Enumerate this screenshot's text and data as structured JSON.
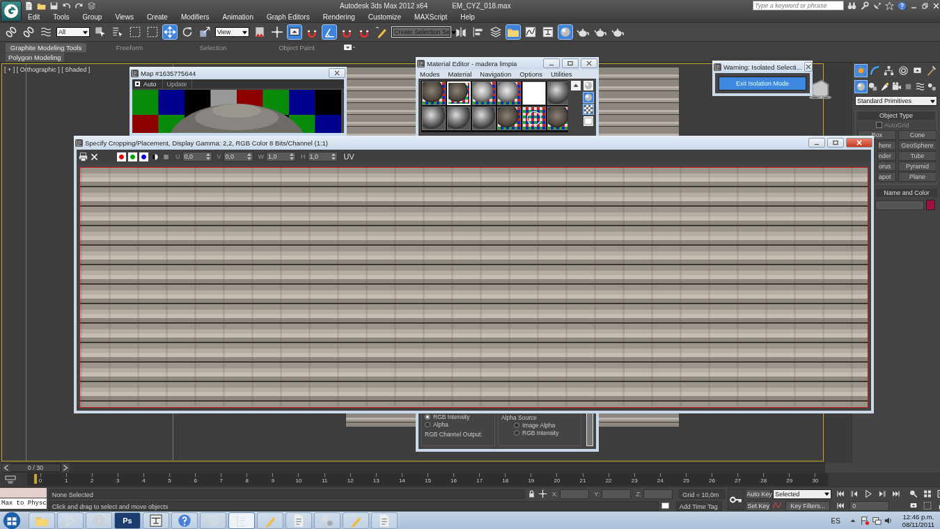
{
  "title_bar": {
    "app": "Autodesk 3ds Max  2012 x64",
    "file": "EM_CYZ_018.max",
    "search": {
      "placeholder": "Type a keyword or phrase"
    }
  },
  "menu": [
    "Edit",
    "Tools",
    "Group",
    "Views",
    "Create",
    "Modifiers",
    "Animation",
    "Graph Editors",
    "Rendering",
    "Customize",
    "MAXScript",
    "Help"
  ],
  "main_toolbar": {
    "selection_filter": "All",
    "reference_coordinate": "View",
    "named_selection": "Create Selection Se",
    "tools": [
      {
        "on": false
      },
      {
        "on": false
      },
      {
        "on": false
      },
      {
        "on": false
      },
      {
        "on": false
      },
      {
        "on": false
      },
      {
        "on": false
      },
      {
        "on": true
      },
      {
        "on": false
      },
      {
        "on": false
      },
      {
        "on": false
      },
      {
        "on": false
      },
      {
        "on": true
      },
      {
        "on": false
      },
      {
        "on": true
      },
      {
        "on": false
      },
      {
        "on": false
      },
      {
        "on": false
      },
      {
        "on": false
      },
      {
        "on": false
      },
      {
        "on": false
      },
      {
        "on": true
      },
      {
        "on": false
      },
      {
        "on": false
      },
      {
        "on": true
      },
      {
        "on": false
      },
      {
        "on": false
      },
      {
        "on": false
      }
    ]
  },
  "ribbon": {
    "tabs": [
      {
        "label": "Graphite Modeling Tools",
        "selected": true
      },
      {
        "label": "Freeform",
        "selected": false
      },
      {
        "label": "Selection",
        "selected": false
      },
      {
        "label": "Object Paint",
        "selected": false
      }
    ],
    "panel": "Polygon Modeling"
  },
  "viewport": {
    "label": "[ + ] [ Orthographic ] [ Shaded ]"
  },
  "map_window": {
    "title": "Map #1635775644",
    "auto": {
      "label": "Auto",
      "checked": true
    },
    "update": "Update"
  },
  "material_editor": {
    "title": "Material Editor - madera limpia",
    "menu": [
      "Modes",
      "Material",
      "Navigation",
      "Options",
      "Utilities"
    ],
    "slots": [
      {
        "kind": "textured",
        "selected": false
      },
      {
        "kind": "textured",
        "selected": true
      },
      {
        "kind": "checkered",
        "selected": false
      },
      {
        "kind": "checkered",
        "selected": false
      },
      {
        "kind": "blank",
        "selected": false
      },
      {
        "kind": "plain",
        "selected": false
      },
      {
        "kind": "plain",
        "selected": false
      },
      {
        "kind": "plain",
        "selected": false
      },
      {
        "kind": "plain",
        "selected": false
      },
      {
        "kind": "textured",
        "selected": false
      },
      {
        "kind": "patterned",
        "selected": false
      },
      {
        "kind": "textured",
        "selected": false
      }
    ],
    "mono_output": [
      {
        "label": "RGB Intensity",
        "selected": true
      },
      {
        "label": "Alpha",
        "selected": false
      }
    ],
    "rgb_channel_output": "RGB Channel Output:",
    "alpha_source": {
      "title": "Alpha Source",
      "options": [
        {
          "label": "Image Alpha",
          "selected": false
        },
        {
          "label": "RGB Intensity",
          "selected": false
        }
      ]
    }
  },
  "warning_window": {
    "title": "Warning: Isolated Selecti...",
    "button": "Exit Isolation Mode"
  },
  "crop_dialog": {
    "title": "Specify Cropping/Placement, Display Gamma: 2,2, RGB Color 8 Bits/Channel (1:1)",
    "channels": [
      {
        "color": "#e00000",
        "on": true
      },
      {
        "color": "#00a000",
        "on": true
      },
      {
        "color": "#0000e0",
        "on": true
      }
    ],
    "fields": [
      {
        "label": "U",
        "value": "0,0"
      },
      {
        "label": "V",
        "value": "0,0"
      },
      {
        "label": "W",
        "value": "1,0"
      },
      {
        "label": "H",
        "value": "1,0"
      }
    ],
    "uv": "UV"
  },
  "command_panel": {
    "tabs": [
      {
        "selected": true
      },
      {
        "selected": false
      },
      {
        "selected": false
      },
      {
        "selected": false
      },
      {
        "selected": false
      },
      {
        "selected": false
      }
    ],
    "categories": [
      {
        "selected": true
      },
      {
        "selected": false
      },
      {
        "selected": false
      },
      {
        "selected": false
      },
      {
        "selected": false
      },
      {
        "selected": false
      },
      {
        "selected": false
      }
    ],
    "type": "Standard Primitives",
    "object_type": {
      "title": "Object Type",
      "autogrid": {
        "label": "AutoGrid",
        "checked": false
      },
      "buttons": [
        "Box",
        "Cone",
        "here",
        "GeoSphere",
        "nder",
        "Tube",
        "orus",
        "Pyramid",
        "apot",
        "Plane"
      ]
    },
    "name_and_color": {
      "title": "Name and Color",
      "color": "#9e1040"
    }
  },
  "timeline": {
    "position": "0 / 30",
    "ticks": [
      "0",
      "1",
      "2",
      "3",
      "4",
      "5",
      "6",
      "7",
      "8",
      "9",
      "10",
      "11",
      "12",
      "13",
      "14",
      "15",
      "16",
      "17",
      "18",
      "19",
      "20",
      "21",
      "22",
      "23",
      "24",
      "25",
      "26",
      "27",
      "28",
      "29",
      "30"
    ]
  },
  "status": {
    "listener": "Max to Physc",
    "selection": "None Selected",
    "prompt": "Click and drag to select and move objects",
    "x_label": "X:",
    "y_label": "Y:",
    "z_label": "Z:",
    "grid": "Grid = 10,0m",
    "add_time_tag": "Add Time Tag",
    "auto_key": "Auto Key",
    "key_mode": "Selected",
    "set_key": "Set Key",
    "key_filters": "Key Filters...",
    "frame": "0"
  },
  "taskbar": {
    "apps": [
      {
        "active": false
      },
      {
        "active": false
      },
      {
        "active": false
      },
      {
        "active": false
      },
      {
        "active": false
      },
      {
        "active": false
      },
      {
        "active": false
      },
      {
        "active": true
      },
      {
        "active": false
      },
      {
        "active": false
      },
      {
        "active": false
      },
      {
        "active": false
      },
      {
        "active": false
      }
    ],
    "ps_label": "Ps",
    "language": "ES",
    "time": "12:46 p.m.",
    "date": "08/11/2011"
  }
}
